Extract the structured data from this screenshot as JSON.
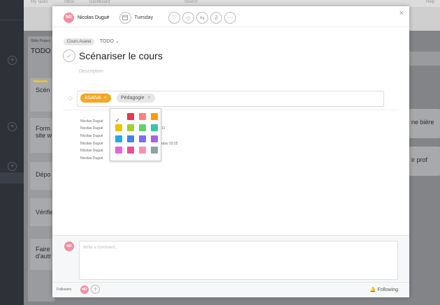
{
  "background": {
    "top_nav": [
      "My Tasks",
      "Inbox",
      "Dashboard",
      "Search",
      "Help"
    ],
    "project_label": "Slide Project",
    "column_title": "TODO",
    "cards": [
      "Scén",
      "Form site w",
      "Dépo",
      "Vérifie",
      "Faire d'autr"
    ],
    "right_cards": [
      "ne bière",
      "ir prof"
    ]
  },
  "modal": {
    "assignee": {
      "initials": "ND",
      "name": "Nicolas Dugué"
    },
    "due_date": "Tuesday",
    "close_icon": "×",
    "breadcrumb": {
      "project": "Cours Asana",
      "section": "TODO"
    },
    "task_title": "Scénariser le cours",
    "description_placeholder": "Description",
    "tags": [
      {
        "label": "ASANA",
        "color": "#f5a623"
      },
      {
        "label": "Pédagogie",
        "color": "#e6e6e6"
      }
    ],
    "activity": [
      {
        "name": "Nicolas Dugué",
        "time": ""
      },
      {
        "name": "Nicolas Dugué",
        "time": ":11"
      },
      {
        "name": "Nicolas Dugué",
        "time": ""
      },
      {
        "name": "Nicolas Dugué",
        "time": "sday  23:15"
      },
      {
        "name": "Nicolas Dugué",
        "time": ""
      },
      {
        "name": "Nicolas Dugué",
        "time": ""
      }
    ],
    "color_palette": [
      "#ffffff",
      "#e8384f",
      "#fd817d",
      "#fd9a00",
      "#eec300",
      "#a4cf30",
      "#62d26f",
      "#37c5ab",
      "#20aaea",
      "#4186e0",
      "#7a6ff0",
      "#aa62e3",
      "#e362e3",
      "#ea4e9d",
      "#fc91ad",
      "#8da3a6"
    ],
    "comment": {
      "initials": "ND",
      "placeholder": "Write a comment..."
    },
    "footer": {
      "followers_label": "Followers",
      "follower_initials": "ND",
      "following_label": "Following"
    }
  }
}
